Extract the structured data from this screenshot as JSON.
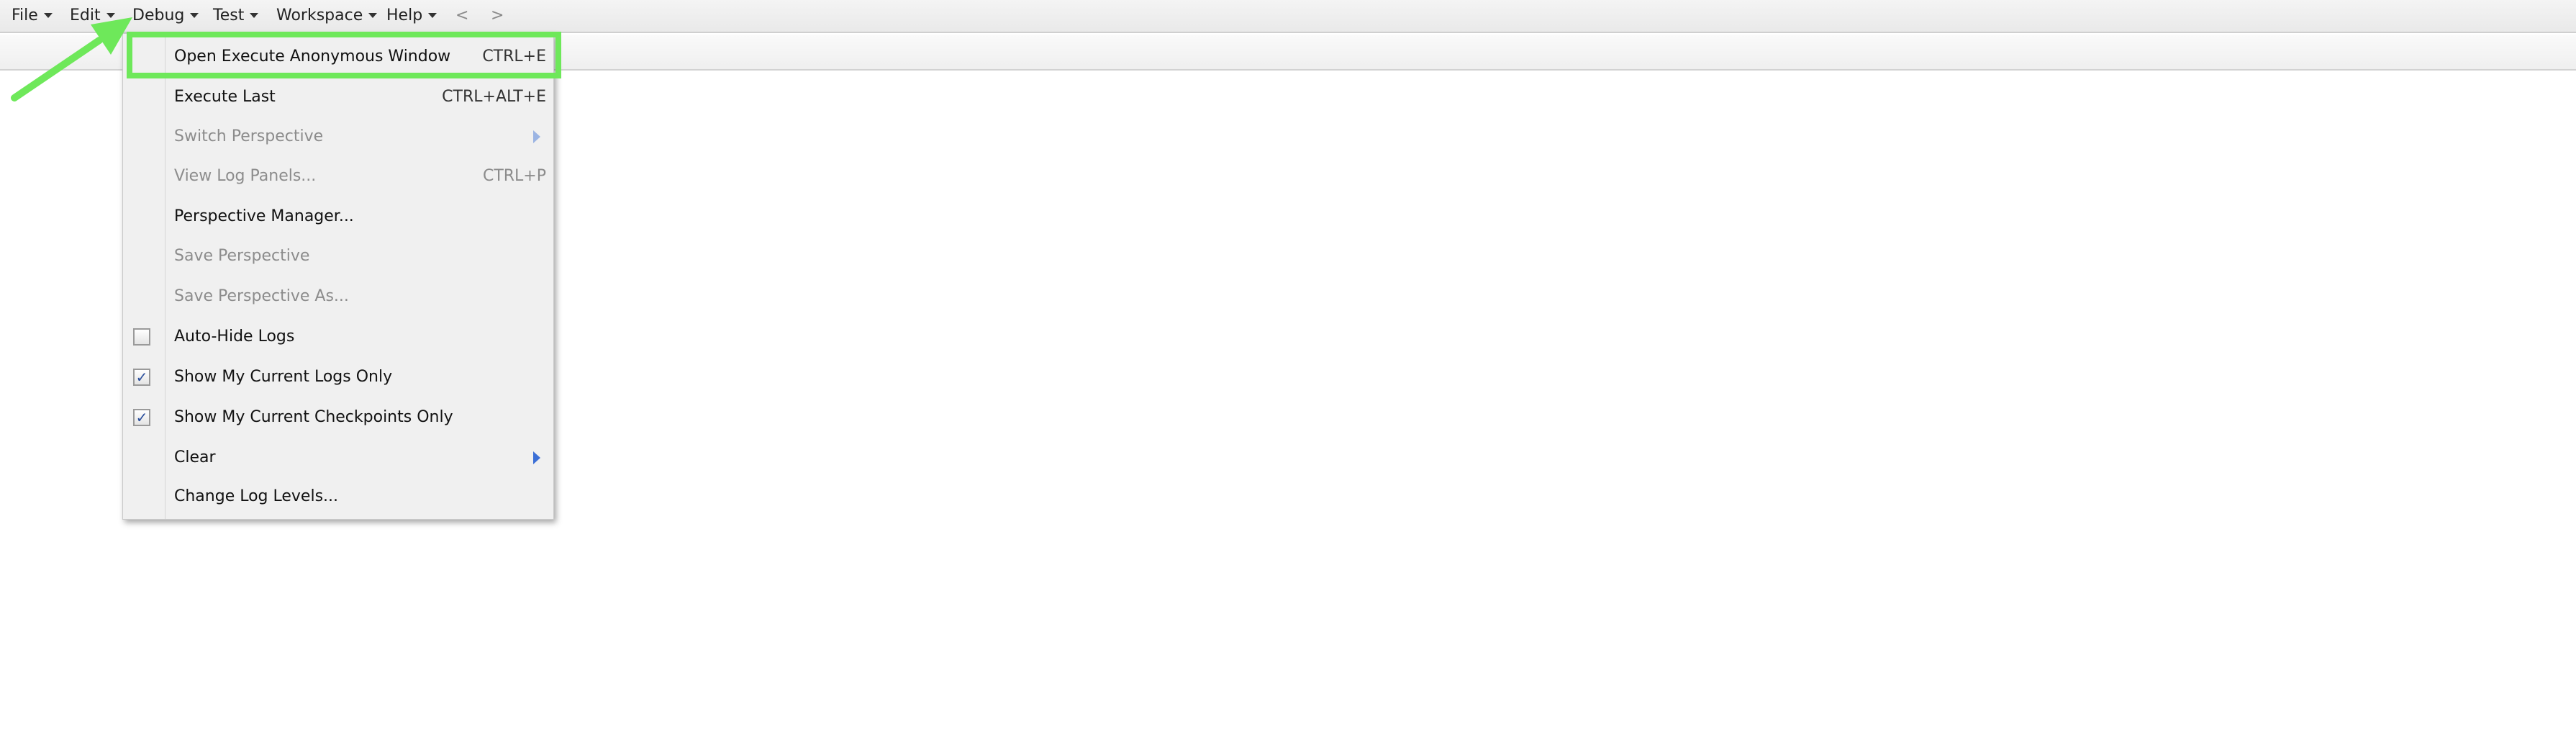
{
  "menubar": {
    "items": [
      {
        "label": "File"
      },
      {
        "label": "Edit"
      },
      {
        "label": "Debug"
      },
      {
        "label": "Test"
      },
      {
        "label": "Workspace"
      },
      {
        "label": "Help"
      }
    ],
    "back": "<",
    "forward": ">"
  },
  "debug_menu": {
    "items": [
      {
        "label": "Open Execute Anonymous Window",
        "shortcut": "CTRL+E",
        "enabled": true,
        "highlighted": true
      },
      {
        "label": "Execute Last",
        "shortcut": "CTRL+ALT+E",
        "enabled": true
      },
      {
        "label": "Switch Perspective",
        "enabled": false,
        "submenu": true
      },
      {
        "label": "View Log Panels...",
        "shortcut": "CTRL+P",
        "enabled": false
      },
      {
        "label": "Perspective Manager...",
        "enabled": true
      },
      {
        "label": "Save Perspective",
        "enabled": false
      },
      {
        "label": "Save Perspective As...",
        "enabled": false
      },
      {
        "label": "Auto-Hide Logs",
        "enabled": true,
        "checked": false
      },
      {
        "label": "Show My Current Logs Only",
        "enabled": true,
        "checked": true
      },
      {
        "label": "Show My Current Checkpoints Only",
        "enabled": true,
        "checked": true
      },
      {
        "label": "Clear",
        "enabled": true,
        "submenu": true
      },
      {
        "label": "Change Log Levels...",
        "enabled": true
      }
    ]
  },
  "checkmark_glyph": "✓",
  "colors": {
    "annotation_green": "#6ee85a",
    "submenu_arrow_blue": "#3b6fd6",
    "disabled_text": "#8c8c8c"
  }
}
